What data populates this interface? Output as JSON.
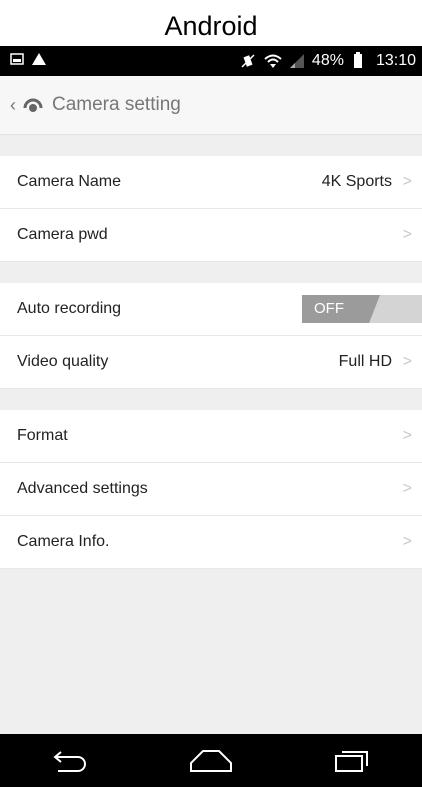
{
  "caption": "Android",
  "statusbar": {
    "battery_percent": "48%",
    "time": "13:10"
  },
  "appbar": {
    "title": "Camera setting"
  },
  "settings": {
    "camera_name": {
      "label": "Camera Name",
      "value": "4K Sports"
    },
    "camera_pwd": {
      "label": "Camera pwd"
    },
    "auto_recording": {
      "label": "Auto recording",
      "toggle": "OFF"
    },
    "video_quality": {
      "label": "Video quality",
      "value": "Full HD"
    },
    "format": {
      "label": "Format"
    },
    "advanced": {
      "label": "Advanced settings"
    },
    "camera_info": {
      "label": "Camera Info."
    }
  },
  "chevron": ">",
  "colors": {
    "statusbar": "#000000",
    "appbar": "#f7f7f7",
    "background": "#efefef",
    "toggle_off": "#9b9b9b"
  }
}
